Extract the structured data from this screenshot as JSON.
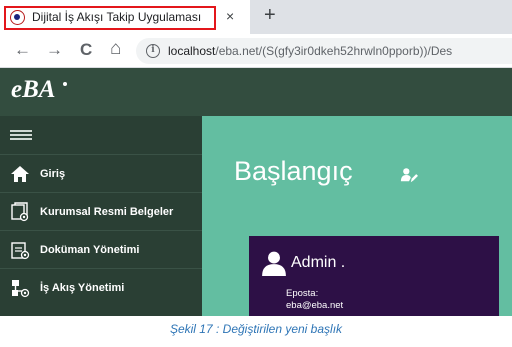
{
  "browser": {
    "tab": {
      "title": "Dijital İş Akışı Takip Uygulaması",
      "close": "×"
    },
    "new_tab": "+",
    "nav": {
      "back": "←",
      "forward": "→",
      "reload": "C",
      "home": "⌂"
    },
    "url": {
      "host": "localhost",
      "path": "/eba.net/(S(gfy3ir0dkeh52hrwln0pporb))/Des"
    },
    "info_symbol": "i",
    "highlight_color": "#e3161b"
  },
  "app": {
    "logo": "eBA",
    "sidebar": {
      "items": [
        {
          "label": "Giriş",
          "icon": "home-icon"
        },
        {
          "label": "Kurumsal Resmi Belgeler",
          "icon": "document-stack-icon"
        },
        {
          "label": "Doküman Yönetimi",
          "icon": "document-manage-icon"
        },
        {
          "label": "İş Akış Yönetimi",
          "icon": "workflow-icon"
        }
      ]
    },
    "main": {
      "title": "Başlangıç",
      "card": {
        "user": "Admin .",
        "email_label": "Eposta:",
        "email": "eba@eba.net"
      }
    },
    "colors": {
      "header": "#334d3f",
      "sidebar": "#2a3f34",
      "main": "#63bea1",
      "card": "#2d1046"
    }
  },
  "caption": "Şekil 17 : Değiştirilen yeni başlık"
}
